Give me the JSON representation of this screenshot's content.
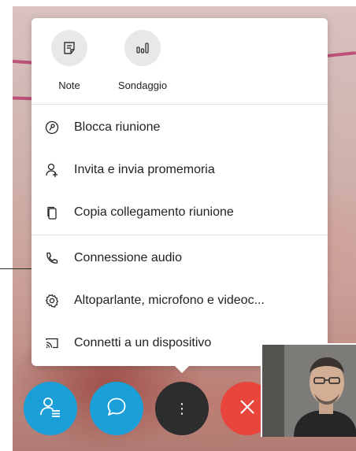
{
  "menu": {
    "quick_actions": [
      {
        "label": "Note",
        "icon": "notes-icon"
      },
      {
        "label": "Sondaggio",
        "icon": "poll-icon"
      }
    ],
    "items": [
      {
        "label": "Blocca riunione",
        "icon": "lock-meeting-icon"
      },
      {
        "label": "Invita e invia promemoria",
        "icon": "add-person-icon"
      },
      {
        "label": "Copia collegamento riunione",
        "icon": "copy-icon"
      },
      {
        "label": "Connessione audio",
        "icon": "phone-icon"
      },
      {
        "label": "Altoparlante, microfono e videoc...",
        "icon": "gear-icon"
      },
      {
        "label": "Connetti a un dispositivo",
        "icon": "cast-icon"
      }
    ]
  },
  "controls": {
    "more_glyph": "⋮"
  },
  "colors": {
    "accent": "#1b9fd9",
    "end_call": "#e8453c",
    "more_button": "#2d2d2d"
  }
}
